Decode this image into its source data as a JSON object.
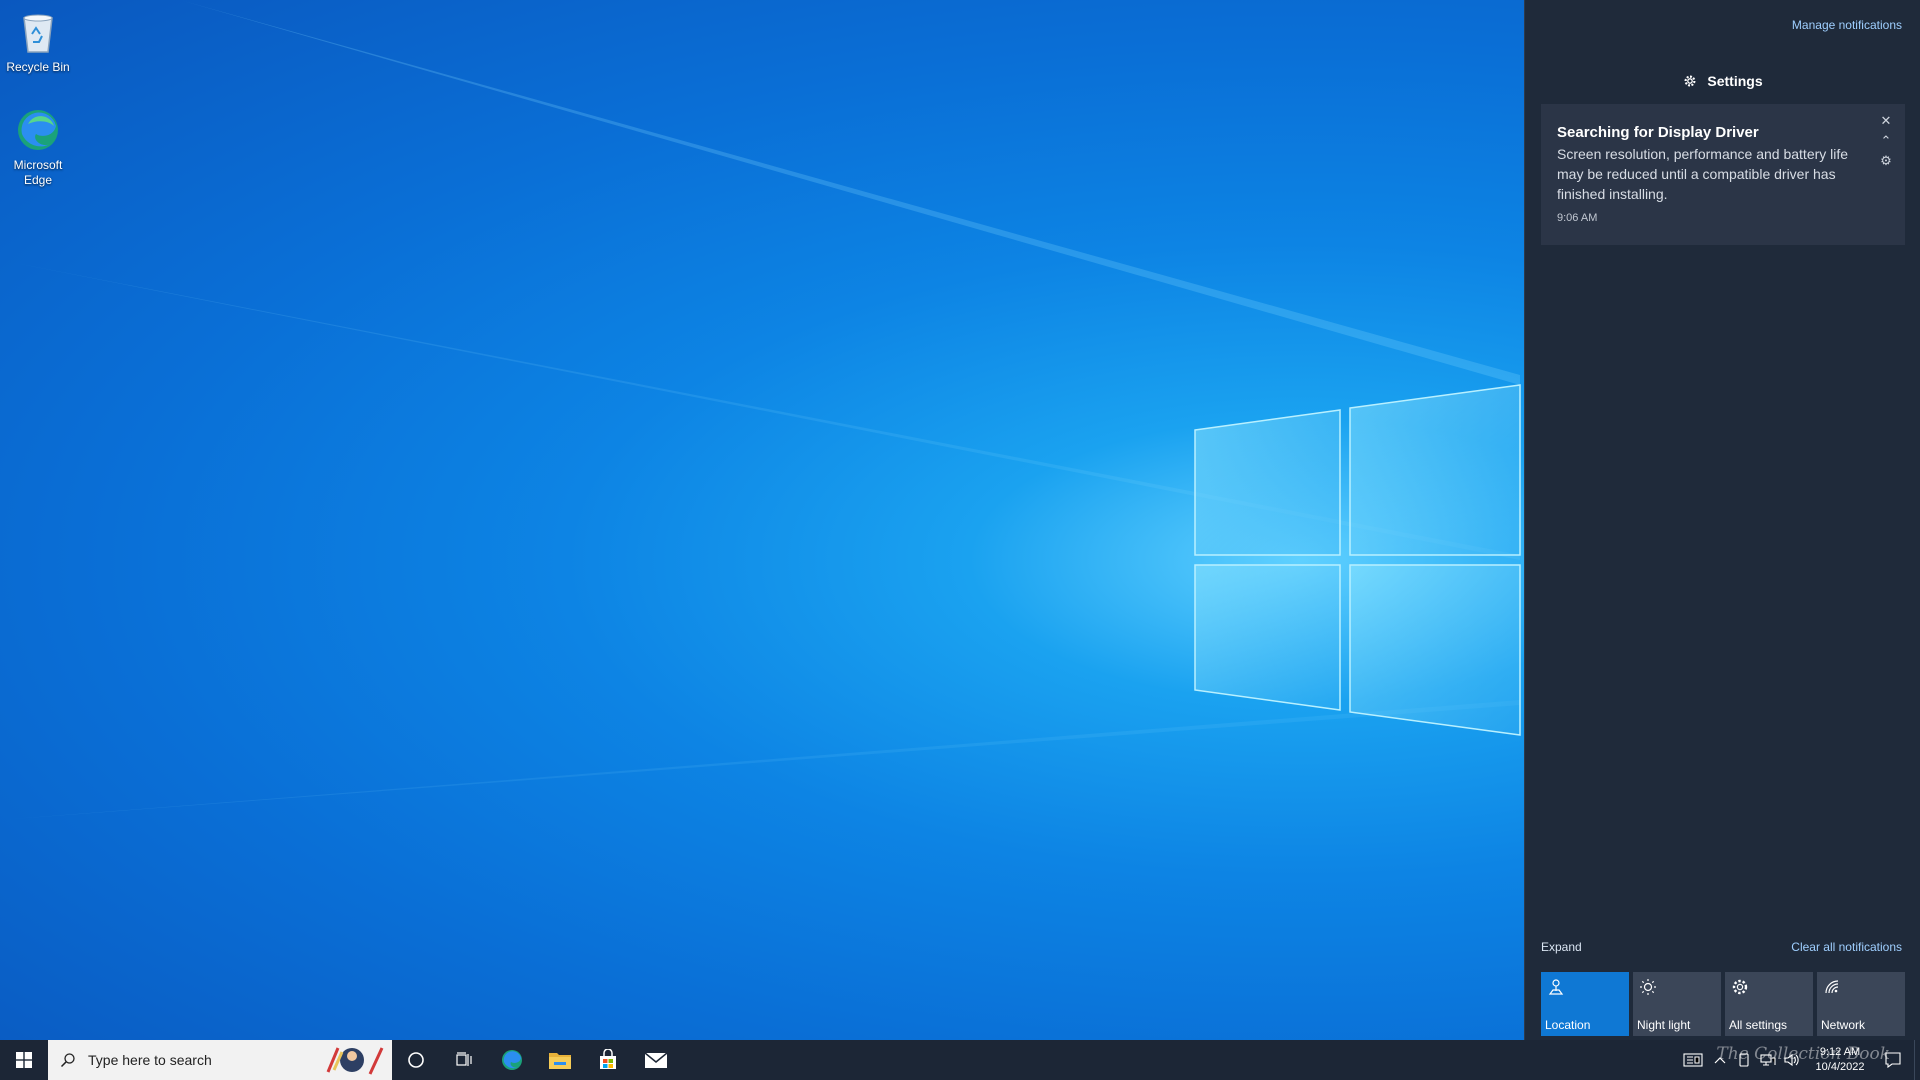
{
  "desktop": {
    "icons": [
      {
        "label": "Recycle Bin",
        "icon": "recycle-bin-icon"
      },
      {
        "label": "Microsoft Edge",
        "icon": "edge-icon"
      }
    ]
  },
  "action_center": {
    "manage_notifications": "Manage notifications",
    "app_header": "Settings",
    "notification": {
      "title": "Searching for Display Driver",
      "body": "Screen resolution, performance and battery life may be reduced until a compatible driver has finished installing.",
      "time": "9:06 AM"
    },
    "expand": "Expand",
    "clear_all": "Clear all notifications",
    "quick_actions": [
      {
        "label": "Location",
        "icon": "location-icon",
        "active": true
      },
      {
        "label": "Night light",
        "icon": "night-light-icon",
        "active": false
      },
      {
        "label": "All settings",
        "icon": "gear-icon",
        "active": false
      },
      {
        "label": "Network",
        "icon": "network-icon",
        "active": false
      }
    ]
  },
  "taskbar": {
    "search_placeholder": "Type here to search",
    "pinned": [
      "cortana-icon",
      "task-view-icon",
      "edge-icon",
      "file-explorer-icon",
      "store-icon",
      "mail-icon"
    ],
    "clock_time": "9:12 AM",
    "clock_date": "10/4/2022"
  },
  "watermark": "The Collection Book",
  "colors": {
    "accent": "#0f78d4",
    "action_center_bg": "#1f2a3a",
    "notification_bg": "#2b3547",
    "link": "#9fcfff"
  }
}
